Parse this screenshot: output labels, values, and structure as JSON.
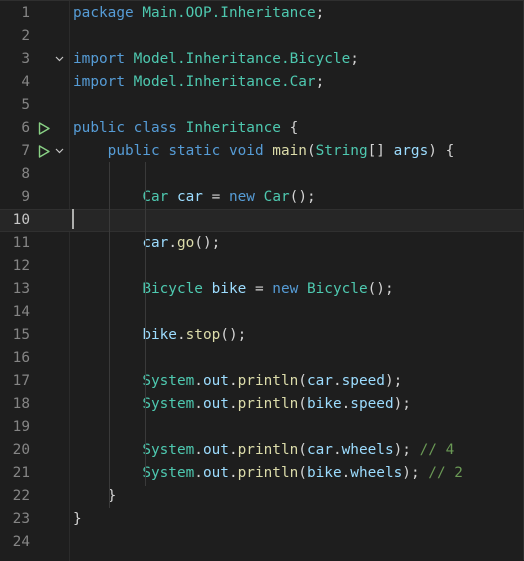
{
  "editor": {
    "cursor_line": 10,
    "lines": [
      {
        "num": "1",
        "tokens": [
          [
            "kw",
            "package"
          ],
          [
            "punc",
            " "
          ],
          [
            "pkg",
            "Main.OOP.Inheritance"
          ],
          [
            "punc",
            ";"
          ]
        ]
      },
      {
        "num": "2",
        "tokens": []
      },
      {
        "num": "3",
        "fold": true,
        "tokens": [
          [
            "kw",
            "import"
          ],
          [
            "punc",
            " "
          ],
          [
            "pkg",
            "Model.Inheritance.Bicycle"
          ],
          [
            "punc",
            ";"
          ]
        ]
      },
      {
        "num": "4",
        "tokens": [
          [
            "kw",
            "import"
          ],
          [
            "punc",
            " "
          ],
          [
            "pkg",
            "Model.Inheritance.Car"
          ],
          [
            "punc",
            ";"
          ]
        ]
      },
      {
        "num": "5",
        "tokens": []
      },
      {
        "num": "6",
        "run": true,
        "tokens": [
          [
            "kw",
            "public"
          ],
          [
            "punc",
            " "
          ],
          [
            "kw",
            "class"
          ],
          [
            "punc",
            " "
          ],
          [
            "cls",
            "Inheritance"
          ],
          [
            "punc",
            " {"
          ]
        ]
      },
      {
        "num": "7",
        "run": true,
        "fold": true,
        "tokens": [
          [
            "punc",
            "    "
          ],
          [
            "kw",
            "public"
          ],
          [
            "punc",
            " "
          ],
          [
            "kw",
            "static"
          ],
          [
            "punc",
            " "
          ],
          [
            "kw",
            "void"
          ],
          [
            "punc",
            " "
          ],
          [
            "fn",
            "main"
          ],
          [
            "punc",
            "("
          ],
          [
            "cls",
            "String"
          ],
          [
            "punc",
            "[] "
          ],
          [
            "var",
            "args"
          ],
          [
            "punc",
            ") {"
          ]
        ]
      },
      {
        "num": "8",
        "tokens": []
      },
      {
        "num": "9",
        "tokens": [
          [
            "punc",
            "        "
          ],
          [
            "cls",
            "Car"
          ],
          [
            "punc",
            " "
          ],
          [
            "var",
            "car"
          ],
          [
            "punc",
            " = "
          ],
          [
            "kw",
            "new"
          ],
          [
            "punc",
            " "
          ],
          [
            "cls",
            "Car"
          ],
          [
            "punc",
            "();"
          ]
        ]
      },
      {
        "num": "10",
        "tokens": []
      },
      {
        "num": "11",
        "tokens": [
          [
            "punc",
            "        "
          ],
          [
            "var",
            "car"
          ],
          [
            "punc",
            "."
          ],
          [
            "fn",
            "go"
          ],
          [
            "punc",
            "();"
          ]
        ]
      },
      {
        "num": "12",
        "tokens": []
      },
      {
        "num": "13",
        "tokens": [
          [
            "punc",
            "        "
          ],
          [
            "cls",
            "Bicycle"
          ],
          [
            "punc",
            " "
          ],
          [
            "var",
            "bike"
          ],
          [
            "punc",
            " = "
          ],
          [
            "kw",
            "new"
          ],
          [
            "punc",
            " "
          ],
          [
            "cls",
            "Bicycle"
          ],
          [
            "punc",
            "();"
          ]
        ]
      },
      {
        "num": "14",
        "tokens": []
      },
      {
        "num": "15",
        "tokens": [
          [
            "punc",
            "        "
          ],
          [
            "var",
            "bike"
          ],
          [
            "punc",
            "."
          ],
          [
            "fn",
            "stop"
          ],
          [
            "punc",
            "();"
          ]
        ]
      },
      {
        "num": "16",
        "tokens": []
      },
      {
        "num": "17",
        "tokens": [
          [
            "punc",
            "        "
          ],
          [
            "cls",
            "System"
          ],
          [
            "punc",
            "."
          ],
          [
            "var",
            "out"
          ],
          [
            "punc",
            "."
          ],
          [
            "fn",
            "println"
          ],
          [
            "punc",
            "("
          ],
          [
            "var",
            "car"
          ],
          [
            "punc",
            "."
          ],
          [
            "var",
            "speed"
          ],
          [
            "punc",
            ");"
          ]
        ]
      },
      {
        "num": "18",
        "tokens": [
          [
            "punc",
            "        "
          ],
          [
            "cls",
            "System"
          ],
          [
            "punc",
            "."
          ],
          [
            "var",
            "out"
          ],
          [
            "punc",
            "."
          ],
          [
            "fn",
            "println"
          ],
          [
            "punc",
            "("
          ],
          [
            "var",
            "bike"
          ],
          [
            "punc",
            "."
          ],
          [
            "var",
            "speed"
          ],
          [
            "punc",
            ");"
          ]
        ]
      },
      {
        "num": "19",
        "tokens": []
      },
      {
        "num": "20",
        "tokens": [
          [
            "punc",
            "        "
          ],
          [
            "cls",
            "System"
          ],
          [
            "punc",
            "."
          ],
          [
            "var",
            "out"
          ],
          [
            "punc",
            "."
          ],
          [
            "fn",
            "println"
          ],
          [
            "punc",
            "("
          ],
          [
            "var",
            "car"
          ],
          [
            "punc",
            "."
          ],
          [
            "var",
            "wheels"
          ],
          [
            "punc",
            "); "
          ],
          [
            "cmt",
            "// 4"
          ]
        ]
      },
      {
        "num": "21",
        "tokens": [
          [
            "punc",
            "        "
          ],
          [
            "cls",
            "System"
          ],
          [
            "punc",
            "."
          ],
          [
            "var",
            "out"
          ],
          [
            "punc",
            "."
          ],
          [
            "fn",
            "println"
          ],
          [
            "punc",
            "("
          ],
          [
            "var",
            "bike"
          ],
          [
            "punc",
            "."
          ],
          [
            "var",
            "wheels"
          ],
          [
            "punc",
            "); "
          ],
          [
            "cmt",
            "// 2"
          ]
        ]
      },
      {
        "num": "22",
        "tokens": [
          [
            "punc",
            "    }"
          ]
        ]
      },
      {
        "num": "23",
        "tokens": [
          [
            "punc",
            "}"
          ]
        ]
      },
      {
        "num": "24",
        "tokens": []
      }
    ]
  },
  "icons": {
    "run": "run-play-icon",
    "fold": "chevron-down-icon"
  },
  "colors": {
    "background": "#1e1e1e",
    "keyword": "#569cd6",
    "type": "#4ec9b0",
    "variable": "#9cdcfe",
    "function": "#dcdcaa",
    "comment": "#6a9955",
    "run_icon": "#89d185"
  }
}
